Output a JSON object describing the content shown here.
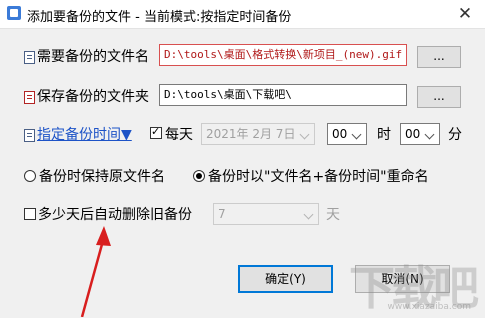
{
  "window": {
    "title": "添加要备份的文件 - 当前模式:按指定时间备份",
    "close_glyph": "✕"
  },
  "source": {
    "label": "需要备份的文件名",
    "path": "D:\\tools\\桌面\\格式转换\\新项目_(new).gif",
    "browse_label": "..."
  },
  "destination": {
    "label": "保存备份的文件夹",
    "path": "D:\\tools\\桌面\\下载吧\\",
    "browse_label": "..."
  },
  "schedule": {
    "link_label": "指定备份时间▼",
    "daily_label": "每天",
    "daily_checked": true,
    "date_value": "2021年 2月 7日",
    "hour_value": "00",
    "hour_unit": "时",
    "minute_value": "00",
    "minute_unit": "分"
  },
  "naming": {
    "keep_label": "备份时保持原文件名",
    "rename_label": "备份时以\"文件名+备份时间\"重命名",
    "selected": "rename"
  },
  "cleanup": {
    "label": "多少天后自动删除旧备份",
    "checked": false,
    "days_value": "7",
    "unit": "天"
  },
  "footer": {
    "ok_label": "确定(Y)",
    "cancel_label": "取消(N)"
  },
  "watermark": {
    "text": "下载吧",
    "subtext": "www.xiazaiba.com"
  },
  "colors": {
    "source_path": "#b01818",
    "link": "#1d53c7",
    "annotation_arrow": "#d81e1e"
  }
}
